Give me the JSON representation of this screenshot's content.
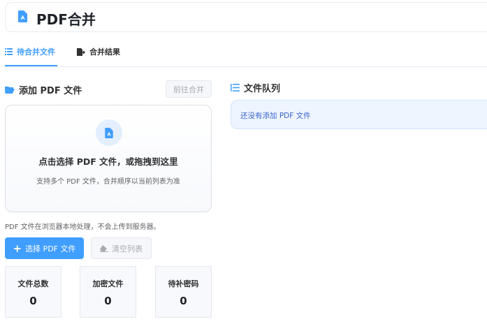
{
  "header": {
    "title": "PDF合并",
    "icon": "pdf-file-icon"
  },
  "tabs": [
    {
      "label": "待合并文件",
      "icon": "list-icon",
      "active": true
    },
    {
      "label": "合并结果",
      "icon": "file-export-icon",
      "active": false
    }
  ],
  "add_section": {
    "title": "添加 PDF 文件",
    "go_merge_label": "前往合并",
    "dropzone": {
      "title": "点击选择 PDF 文件，或拖拽到这里",
      "subtitle": "支持多个 PDF 文件，合并顺序以当前列表为准"
    },
    "note": "PDF 文件在浏览器本地处理，不会上传到服务器。",
    "select_label": "选择 PDF 文件",
    "clear_label": "清空列表"
  },
  "stats": [
    {
      "label": "文件总数",
      "value": "0"
    },
    {
      "label": "加密文件",
      "value": "0"
    },
    {
      "label": "待补密码",
      "value": "0"
    }
  ],
  "queue": {
    "title": "文件队列",
    "empty_text": "还没有添加 PDF 文件"
  },
  "colors": {
    "accent": "#409eff"
  }
}
